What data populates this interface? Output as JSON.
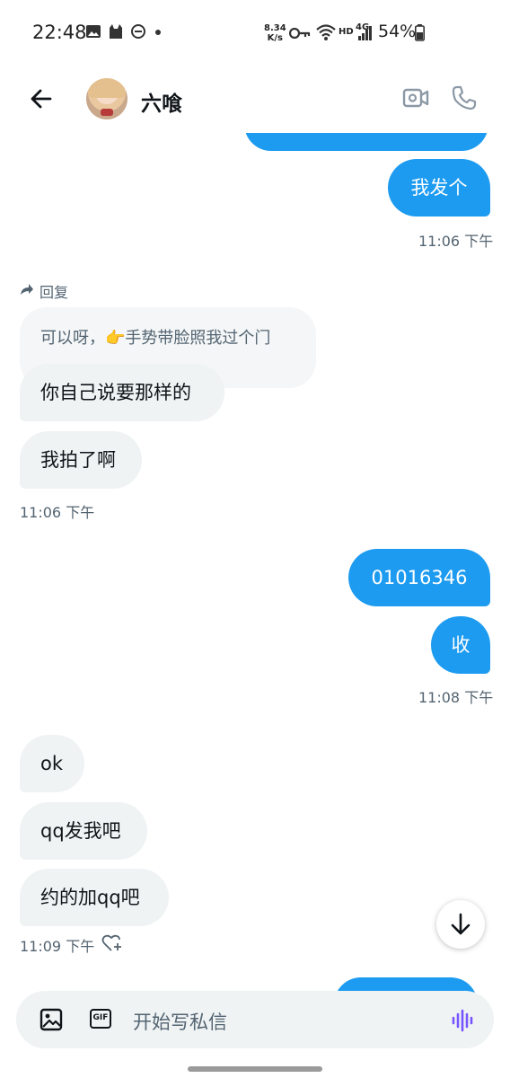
{
  "status_bar": {
    "time": "22:48",
    "net_speed_value": "8.34",
    "net_speed_unit": "K/s",
    "hd": "HD",
    "network": "4G",
    "battery": "54%"
  },
  "header": {
    "contact_name": "六喰"
  },
  "messages": {
    "m1": "我发个",
    "t1": "11:06 下午",
    "reply_label": "回复",
    "reply_quote": "可以呀，👉手势带脸照我过个门",
    "m2": "你自己说要那样的",
    "m3": "我拍了啊",
    "t2": "11:06 下午",
    "m4": "01016346",
    "m5": "收",
    "t3": "11:08 下午",
    "m6": "ok",
    "m7": "qq发我吧",
    "m8": "约的加qq吧",
    "t4": "11:09 下午"
  },
  "composer": {
    "placeholder": "开始写私信",
    "gif_label": "GIF"
  },
  "colors": {
    "accent": "#1d9bf0",
    "incoming_bubble": "#eff3f4",
    "voice_icon": "#7856ff"
  },
  "icons": [
    "back-arrow-icon",
    "video-call-icon",
    "phone-icon",
    "reply-arrow-icon",
    "heart-add-icon",
    "scroll-down-icon",
    "image-icon",
    "gif-icon",
    "voice-icon"
  ]
}
